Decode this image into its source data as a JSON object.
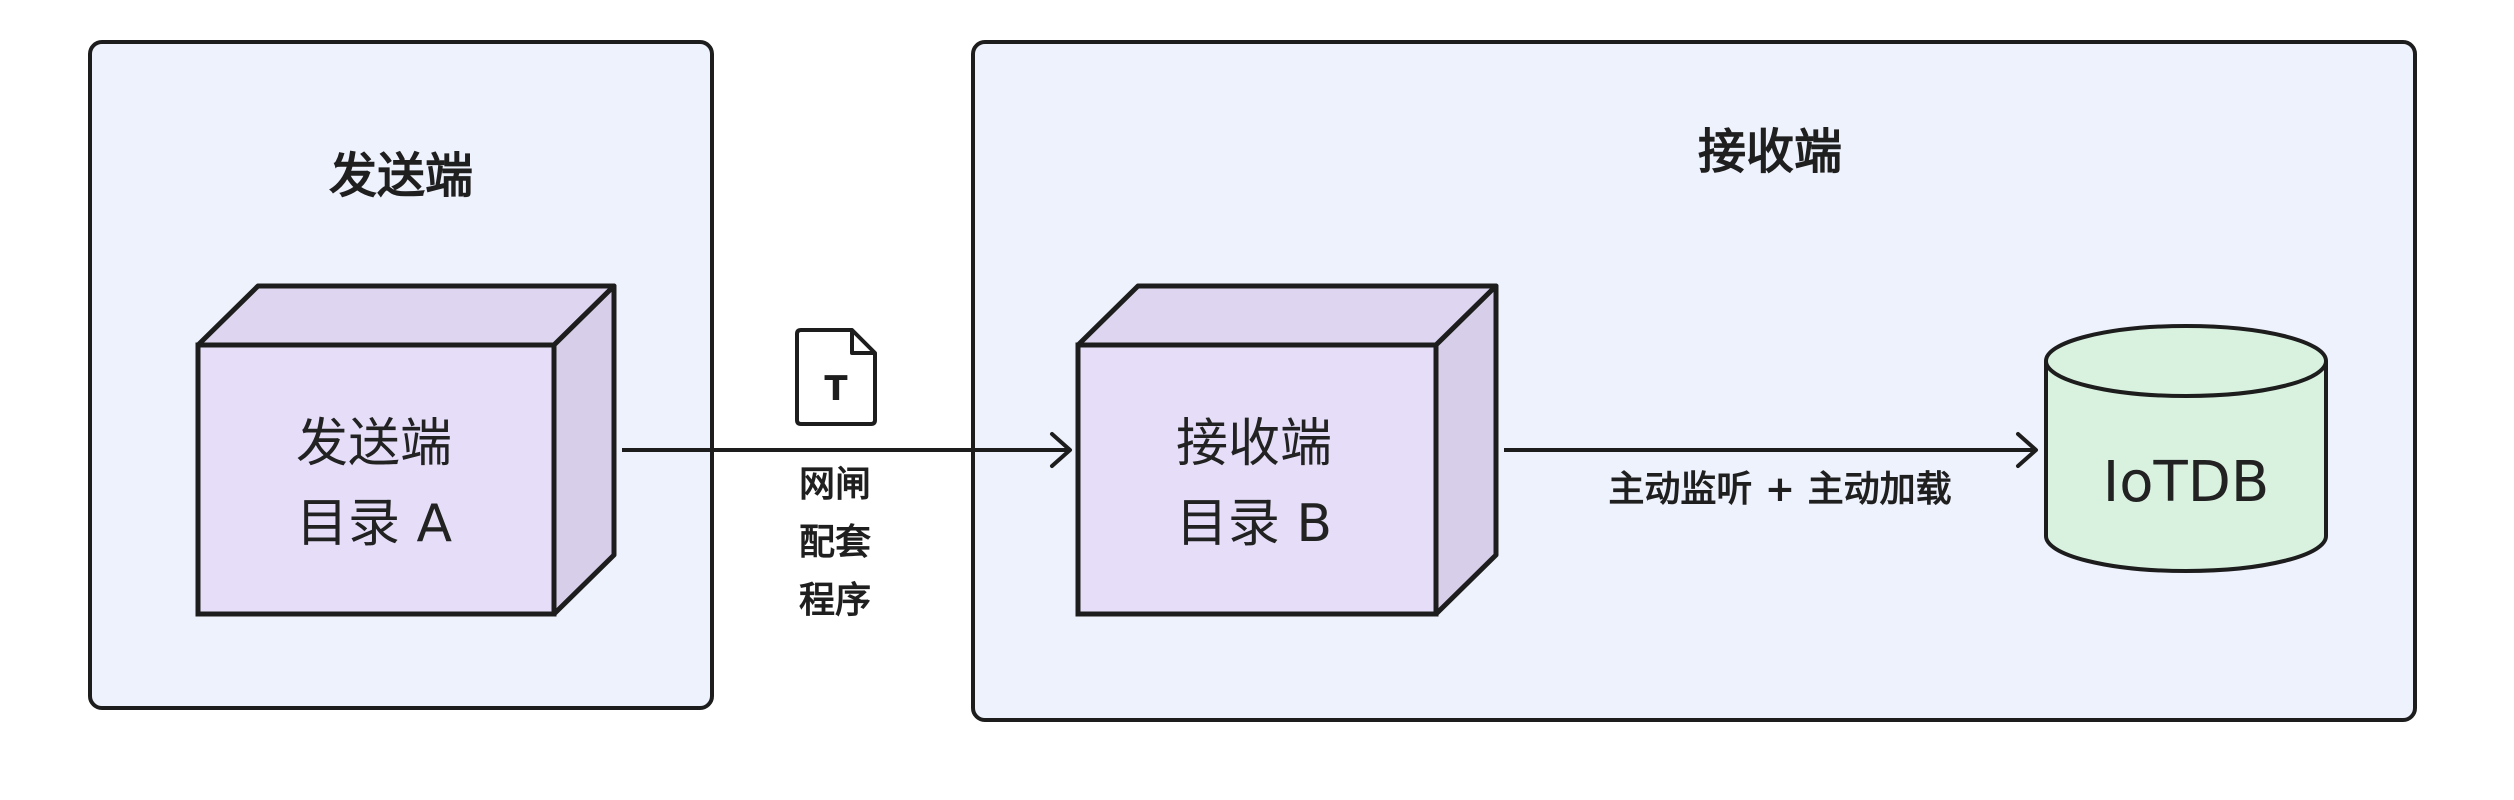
{
  "sender": {
    "title": "发送端",
    "box_line1": "发送端",
    "box_line2": "目录 A"
  },
  "receiver": {
    "title": "接收端",
    "box_line1": "接收端",
    "box_line2": "目录 B"
  },
  "gateway": {
    "file_icon_letter": "T",
    "label_lines": [
      "网闸",
      "配套",
      "程序"
    ]
  },
  "action_label": "主动监听 + 主动加载",
  "database": {
    "label": "IoTDB"
  },
  "colors": {
    "panel_fill": "#eef2fc",
    "cube_front": "#e6def8",
    "cube_side": "#d7cfe9",
    "cube_top": "#ded6f0",
    "db_fill": "#d9f2e0",
    "stroke": "#1d1d1d"
  }
}
